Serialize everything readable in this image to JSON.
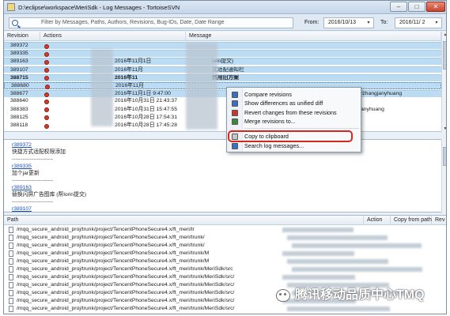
{
  "window": {
    "title": "D:\\eclipse\\workspace\\MeriSdk - Log Messages - TortoiseSVN",
    "minimize": "–",
    "maximize": "□",
    "close": "✕"
  },
  "filter": {
    "placeholder": "Filter by Messages, Paths, Authors, Revisions, Bug-IDs, Date, Date Range",
    "from_label": "From:",
    "from_value": "2016/10/13",
    "to_label": "To:",
    "to_value": "2016/11/ 2",
    "dropdown_glyph": "▾"
  },
  "revisions": {
    "columns": [
      "Revision",
      "Actions",
      "Message"
    ],
    "rows": [
      {
        "rev": "389372",
        "date": "",
        "msg": "",
        "extra": ""
      },
      {
        "rev": "389335",
        "date": "",
        "msg": "",
        "extra": ""
      },
      {
        "rev": "389163",
        "date": "2016年11月1日",
        "msg": "orin提交)",
        "extra": ""
      },
      {
        "rev": "389107",
        "date": "2016年11月",
        "msg": "式适配通知栏",
        "extra": ""
      },
      {
        "rev": "388715",
        "date": "2016年11",
        "msg": "然用旧方案",
        "extra": ""
      },
      {
        "rev": "388680",
        "date": "2016年11月",
        "msg": "",
        "extra": ""
      },
      {
        "rev": "388677",
        "date": "2016年11月1日 9:47:00",
        "msg": "",
        "extra": "rzhangjanyhuang"
      },
      {
        "rev": "388640",
        "date": "2016年10月31日 21:43:37",
        "msg": "",
        "extra": ""
      },
      {
        "rev": "388383",
        "date": "2016年10月31日 15:47:55",
        "msg": "",
        "extra": "anyhuang"
      },
      {
        "rev": "388125",
        "date": "2016年10月28日 17:54:31",
        "msg": "",
        "extra": ""
      },
      {
        "rev": "388118",
        "date": "2016年10月28日 17:45:28",
        "msg": "",
        "extra": ""
      }
    ]
  },
  "context_menu": {
    "items": [
      {
        "label": "Compare revisions",
        "icon": "compare-icon"
      },
      {
        "label": "Show differences as unified diff",
        "icon": "diff-icon"
      },
      {
        "label": "Revert changes from these revisions",
        "icon": "revert-icon"
      },
      {
        "label": "Merge revisions to...",
        "icon": "merge-icon"
      },
      {
        "label": "Copy to clipboard",
        "icon": "clipboard-icon"
      },
      {
        "label": "Search log messages...",
        "icon": "search-icon"
      }
    ]
  },
  "message_pane": {
    "lines": [
      {
        "text": "r389372",
        "kind": "link"
      },
      {
        "text": "快捷方式适配权限添加",
        "kind": "text"
      },
      {
        "text": "-----------------------",
        "kind": "sep"
      },
      {
        "text": "r389335",
        "kind": "link"
      },
      {
        "text": "加个jar更新",
        "kind": "text"
      },
      {
        "text": "-----------------------",
        "kind": "sep"
      },
      {
        "text": "r389163",
        "kind": "link"
      },
      {
        "text": "替换闪屏广告图库 (帮lorin提交)",
        "kind": "text"
      },
      {
        "text": "-----------------------",
        "kind": "sep"
      },
      {
        "text": "r389107",
        "kind": "link"
      }
    ]
  },
  "paths": {
    "columns": {
      "path": "Path",
      "action": "Action",
      "copy_from_path": "Copy from path",
      "rev": "Rev"
    },
    "rows": [
      "/mqq_secure_android_proj/trunk/project/TencentPhoneSecure4.x/ft_meri/tr",
      "/mqq_secure_android_proj/trunk/project/TencentPhoneSecure4.x/ft_meri/trunk/",
      "/mqq_secure_android_proj/trunk/project/TencentPhoneSecure4.x/ft_meri/trunk/",
      "/mqq_secure_android_proj/trunk/project/TencentPhoneSecure4.x/ft_meri/trunk/M",
      "/mqq_secure_android_proj/trunk/project/TencentPhoneSecure4.x/ft_meri/trunk/M",
      "/mqq_secure_android_proj/trunk/project/TencentPhoneSecure4.x/ft_meri/trunk/MeriSdk/src",
      "/mqq_secure_android_proj/trunk/project/TencentPhoneSecure4.x/ft_meri/trunk/MeriSdk/src/",
      "/mqq_secure_android_proj/trunk/project/TencentPhoneSecure4.x/ft_meri/trunk/MeriSdk/src/",
      "/mqq_secure_android_proj/trunk/project/TencentPhoneSecure4.x/ft_meri/trunk/MeriSdk/src/",
      "/mqq_secure_android_proj/trunk/project/TencentPhoneSecure4.x/ft_meri/trunk/MeriSdk/src/",
      "/mqq_secure_android_proj/trunk/project/TencentPhoneSecure4.x/ft_meri/trunk/MeriSdk/src/"
    ]
  },
  "watermark": {
    "text": "腾讯移动品质中心TMQ"
  },
  "colors": {
    "selection": "#bcdcf4",
    "highlight": "#d9261c",
    "link": "#1b4fb8"
  }
}
